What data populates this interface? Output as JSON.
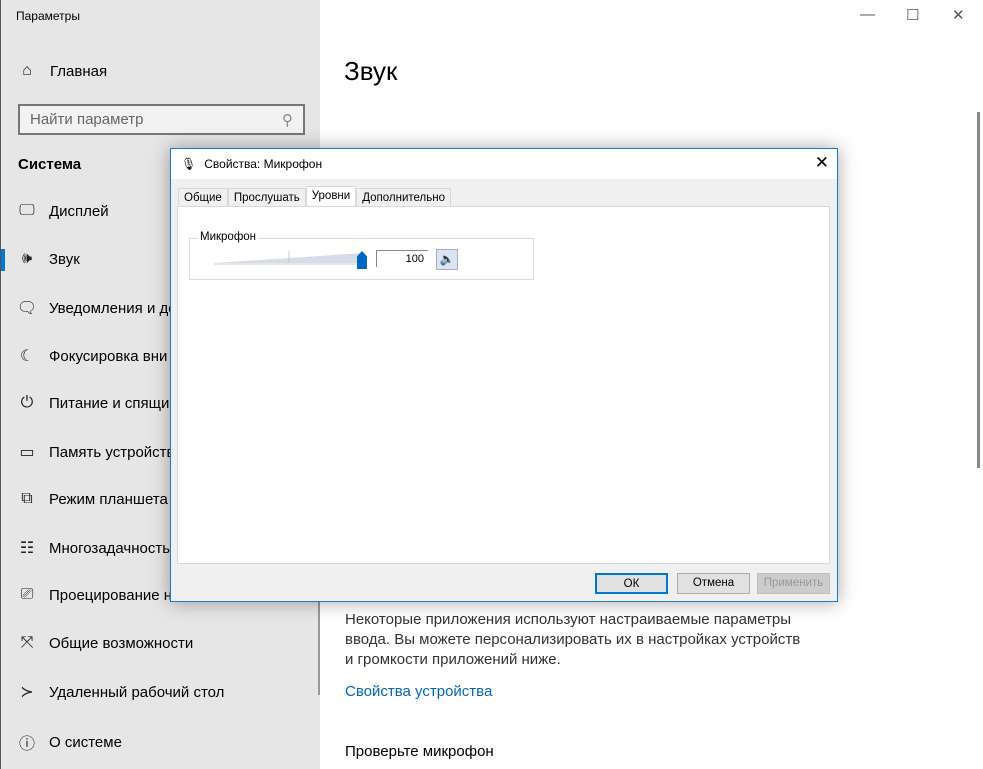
{
  "app": {
    "title": "Параметры",
    "home": "Главная",
    "search_placeholder": "Найти параметр",
    "section": "Система",
    "nav": [
      {
        "label": "Дисплей",
        "icon": "display-icon"
      },
      {
        "label": "Звук",
        "icon": "sound-icon"
      },
      {
        "label": "Уведомления и де",
        "icon": "notifications-icon"
      },
      {
        "label": "Фокусировка вни",
        "icon": "moon-icon"
      },
      {
        "label": "Питание и спящи",
        "icon": "power-icon"
      },
      {
        "label": "Память устройств",
        "icon": "storage-icon"
      },
      {
        "label": "Режим планшета",
        "icon": "tablet-icon"
      },
      {
        "label": "Многозадачность",
        "icon": "multitask-icon"
      },
      {
        "label": "Проецирование н",
        "icon": "project-icon"
      },
      {
        "label": "Общие возможности",
        "icon": "shared-icon"
      },
      {
        "label": "Удаленный рабочий стол",
        "icon": "remote-icon"
      },
      {
        "label": "О системе",
        "icon": "info-icon"
      }
    ],
    "active": "Звук"
  },
  "main": {
    "heading": "Звук",
    "paragraph": "Некоторые приложения используют настраиваемые параметры ввода. Вы можете персонализировать их в настройках устройств и громкости приложений ниже.",
    "link": "Свойства устройства",
    "subheading": "Проверьте микрофон"
  },
  "dialog": {
    "title": "Свойства: Микрофон",
    "tabs": [
      "Общие",
      "Прослушать",
      "Уровни",
      "Дополнительно"
    ],
    "selected_tab": "Уровни",
    "group_label": "Микрофон",
    "level": "100",
    "level_percent": 100,
    "ok": "ОК",
    "cancel": "Отмена",
    "apply": "Применить",
    "accent": "#0067c0"
  }
}
